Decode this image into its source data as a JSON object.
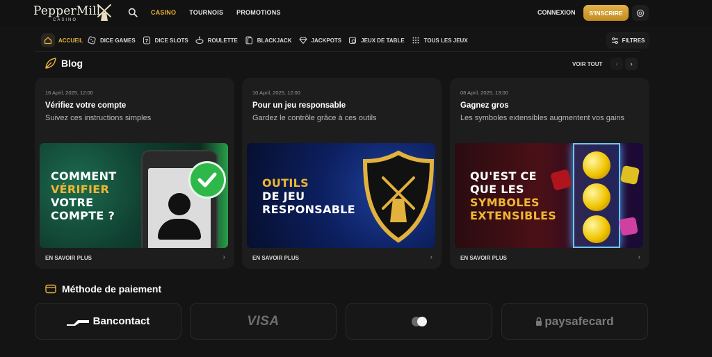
{
  "header": {
    "brand": "PepperMill",
    "brand_sub": "CASINO",
    "nav": [
      "CASINO",
      "TOURNOIS",
      "PROMOTIONS"
    ],
    "nav_active": "CASINO",
    "login_label": "CONNEXION",
    "signup_label": "S'INSCRIRE",
    "accent_color": "#e8b43c"
  },
  "categories": {
    "home": "ACCUEIL",
    "items": [
      "DICE GAMES",
      "DICE SLOTS",
      "ROULETTE",
      "BLACKJACK",
      "JACKPOTS",
      "JEUX DE TABLE",
      "TOUS LES JEUX"
    ],
    "filters_label": "FILTRES"
  },
  "blog": {
    "title": "Blog",
    "see_all": "VOIR TOUT",
    "cards": [
      {
        "date": "16 April, 2025, 12:00",
        "title": "Vérifiez votre compte",
        "subtitle": "Suivez ces instructions simples",
        "image_lines": [
          "COMMENT",
          "VÉRIFIER",
          "VOTRE",
          "COMPTE ?"
        ],
        "more": "EN SAVOIR PLUS"
      },
      {
        "date": "10 April, 2025, 12:00",
        "title": "Pour un jeu responsable",
        "subtitle": "Gardez le contrôle grâce à ces outils",
        "image_lines": [
          "OUTILS",
          "DE JEU",
          "RESPONSABLE"
        ],
        "more": "EN SAVOIR PLUS"
      },
      {
        "date": "08 April, 2025, 13:00",
        "title": "Gagnez gros",
        "subtitle": "Les symboles extensibles augmentent vos gains",
        "image_lines": [
          "QU'EST CE",
          "QUE LES",
          "SYMBOLES",
          "EXTENSIBLES"
        ],
        "more": "EN SAVOIR PLUS"
      }
    ]
  },
  "payments": {
    "title": "Méthode de paiement",
    "methods": [
      "Bancontact",
      "VISA",
      "Mastercard",
      "paysafecard"
    ]
  }
}
